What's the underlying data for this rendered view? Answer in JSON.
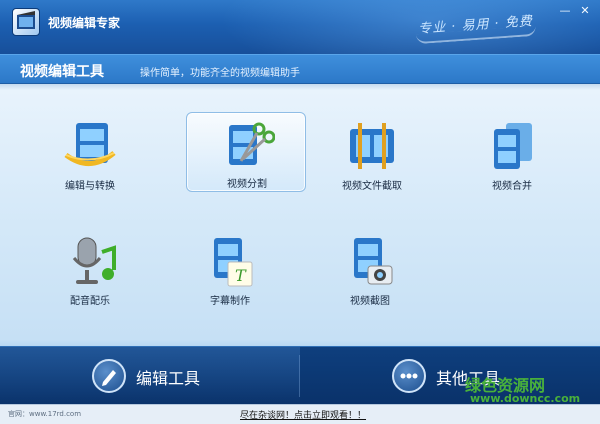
{
  "window": {
    "title": "视频编辑专家",
    "slogan": "专业 · 易用 · 免费",
    "minimize_glyph": "—",
    "close_glyph": "✕"
  },
  "section": {
    "title": "视频编辑工具",
    "subtitle": "操作简单，功能齐全的视频编辑助手"
  },
  "tools": [
    {
      "label": "编辑与转换",
      "icon": "film-convert-icon"
    },
    {
      "label": "视频分割",
      "icon": "film-scissors-icon",
      "selected": true
    },
    {
      "label": "视频文件截取",
      "icon": "film-clip-icon"
    },
    {
      "label": "视频合并",
      "icon": "film-merge-icon"
    },
    {
      "label": "配音配乐",
      "icon": "microphone-music-icon"
    },
    {
      "label": "字幕制作",
      "icon": "film-subtitle-icon"
    },
    {
      "label": "视频截图",
      "icon": "film-camera-icon"
    }
  ],
  "bottom_tabs": [
    {
      "label": "编辑工具",
      "icon": "pencil-icon",
      "active": true
    },
    {
      "label": "其他工具",
      "icon": "dots-icon",
      "active": false
    }
  ],
  "watermark": {
    "text": "绿色资源网",
    "url": "www.downcc.com"
  },
  "status": {
    "site": "官网：www.17rd.com",
    "promo": "尽在杂谈网！点击立即观看！！"
  },
  "colors": {
    "title_bar": "#1c5fb1",
    "section_bar": "#2c78c8",
    "panel": "#d7eaf9",
    "bottom_bar": "#0a326a",
    "watermark": "#49b13b"
  }
}
